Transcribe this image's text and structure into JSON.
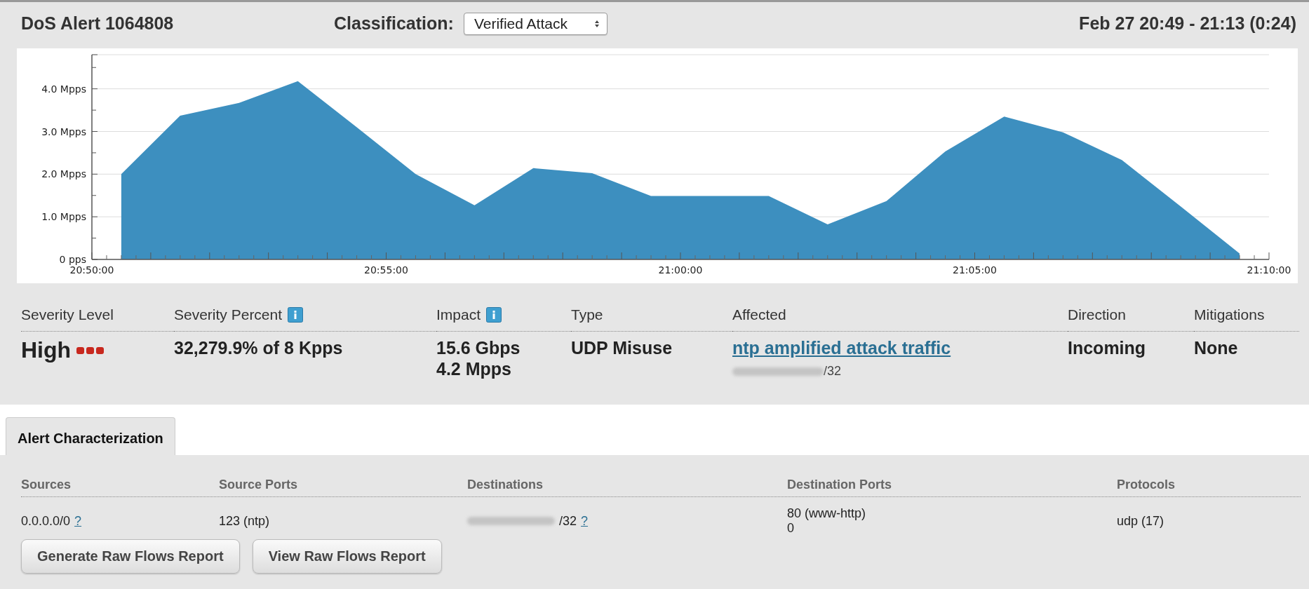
{
  "header": {
    "title": "DoS Alert 1064808",
    "classification_label": "Classification:",
    "classification": "Verified Attack",
    "time_range": "Feb 27 20:49 - 21:13 (0:24)"
  },
  "traffic": {
    "chart_data": {
      "type": "area",
      "x": [
        75030,
        75030,
        75090,
        75150,
        75210,
        75270,
        75330,
        75390,
        75450,
        75510,
        75570,
        75630,
        75690,
        75750,
        75810,
        75870,
        75930,
        75990,
        76050,
        76110,
        76170
      ],
      "series": [
        {
          "color": "#3d8fbf",
          "values": [
            0,
            2.0,
            3.37,
            3.67,
            4.18,
            3.1,
            2.0,
            1.27,
            2.14,
            2.02,
            1.49,
            1.49,
            1.49,
            0.82,
            1.37,
            2.53,
            3.35,
            2.98,
            2.33,
            1.24,
            0.14
          ]
        }
      ],
      "grid": true,
      "xlim": [
        75000,
        76200
      ],
      "ylim": [
        0,
        4.8
      ],
      "xticks": [
        {
          "value": 75000,
          "label": "20:50:00"
        },
        {
          "value": 75300,
          "label": "20:55:00"
        },
        {
          "value": 75600,
          "label": "21:00:00"
        },
        {
          "value": 75900,
          "label": "21:05:00"
        },
        {
          "value": 76200,
          "label": "21:10:00"
        }
      ],
      "yticks": [
        {
          "value": 0,
          "label": "0 pps"
        },
        {
          "value": 1,
          "label": "1.0 Mpps"
        },
        {
          "value": 2,
          "label": "2.0 Mpps"
        },
        {
          "value": 3,
          "label": "3.0 Mpps"
        },
        {
          "value": 4,
          "label": "4.0 Mpps"
        }
      ]
    }
  },
  "summary": [
    {
      "label": "Severity Level",
      "kind": "severity",
      "lines": [
        "High"
      ],
      "info": false
    },
    {
      "label": "Severity Percent",
      "kind": "text",
      "lines": [
        "32,279.9% of 8 Kpps"
      ],
      "info": true
    },
    {
      "label": "Impact",
      "kind": "text",
      "lines": [
        "15.6 Gbps",
        "4.2 Mpps"
      ],
      "info": true
    },
    {
      "label": "Type",
      "kind": "text",
      "lines": [
        "UDP Misuse"
      ],
      "info": false
    },
    {
      "label": "Affected",
      "kind": "link",
      "lines": [
        "ntp amplified attack traffic"
      ],
      "suffix": "/32",
      "info": false
    },
    {
      "label": "Direction",
      "kind": "text",
      "lines": [
        "Incoming"
      ],
      "info": false
    },
    {
      "label": "Mitigations",
      "kind": "text",
      "lines": [
        "None"
      ],
      "info": false
    }
  ],
  "tabs": [
    {
      "label": "Alert Characterization",
      "selected": true
    }
  ],
  "table": {
    "columns": [
      "Sources",
      "Source Ports",
      "Destinations",
      "Destination Ports",
      "Protocols"
    ],
    "row": [
      {
        "lines": [
          "0.0.0.0/0"
        ],
        "help": "?",
        "redacted": false
      },
      {
        "lines": [
          "123 (ntp)"
        ],
        "redacted": false
      },
      {
        "lines": [
          "/32"
        ],
        "help": "?",
        "redacted": true
      },
      {
        "lines": [
          "80 (www-http)",
          "0"
        ],
        "redacted": false
      },
      {
        "lines": [
          "udp (17)"
        ],
        "redacted": false
      }
    ]
  },
  "buttons": [
    "Generate Raw Flows Report",
    "View Raw Flows Report"
  ]
}
